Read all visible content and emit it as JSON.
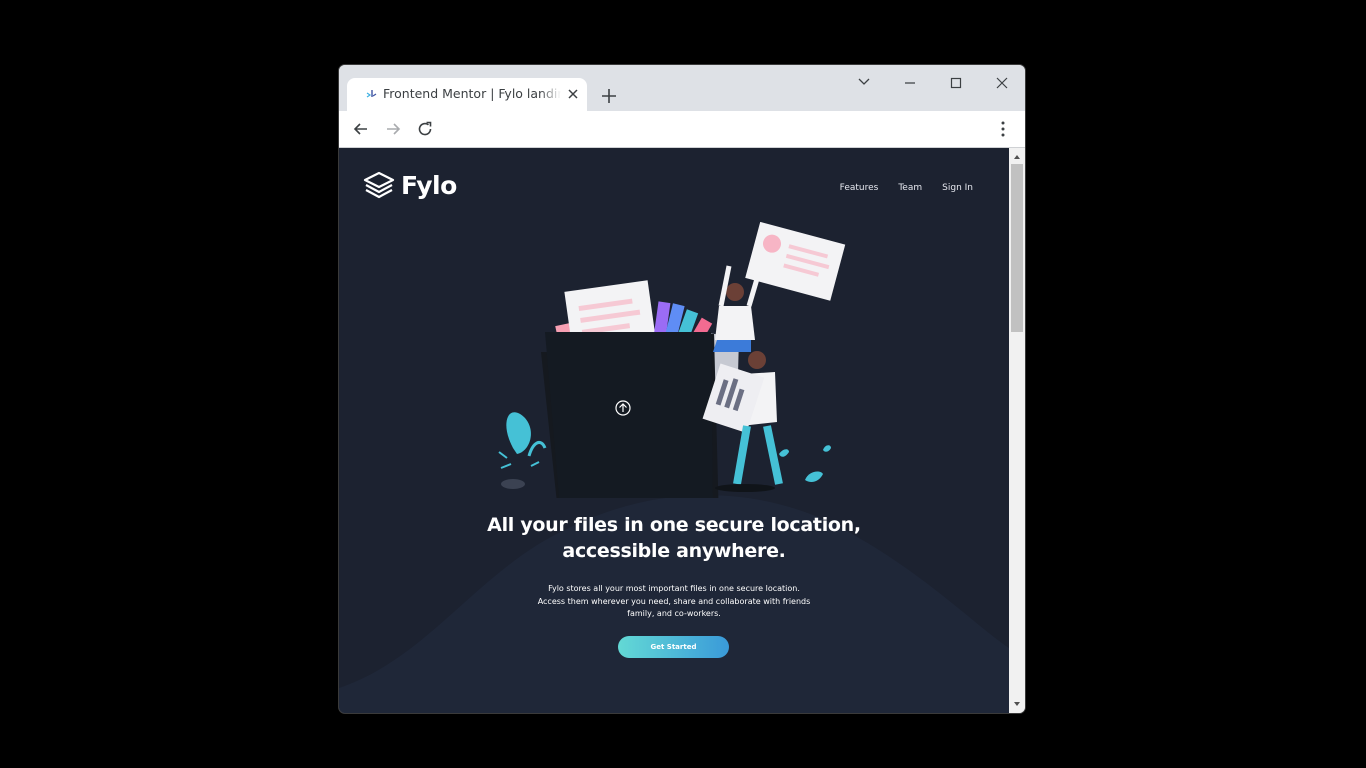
{
  "browser": {
    "tab_title": "Frontend Mentor | Fylo landing page",
    "favicon": "frontend-mentor-icon",
    "controls": [
      "tab-search-icon",
      "minimize-icon",
      "maximize-icon",
      "close-icon"
    ]
  },
  "toolbar": {
    "icons": [
      "back-arrow-icon",
      "forward-arrow-icon",
      "reload-icon",
      "kebab-menu-icon"
    ]
  },
  "page": {
    "logo_text": "Fylo",
    "nav": [
      "Features",
      "Team",
      "Sign In"
    ],
    "headline_line1": "All your files in one secure location,",
    "headline_line2": "accessible anywhere.",
    "subtext": "Fylo stores all your most important files in one secure location. Access them wherever you need, share and collaborate with friends family, and co-workers.",
    "cta_label": "Get Started"
  },
  "colors": {
    "page_bg": "#1c2230",
    "cta_gradient_start": "#63d9d5",
    "cta_gradient_end": "#3a9ad9"
  }
}
